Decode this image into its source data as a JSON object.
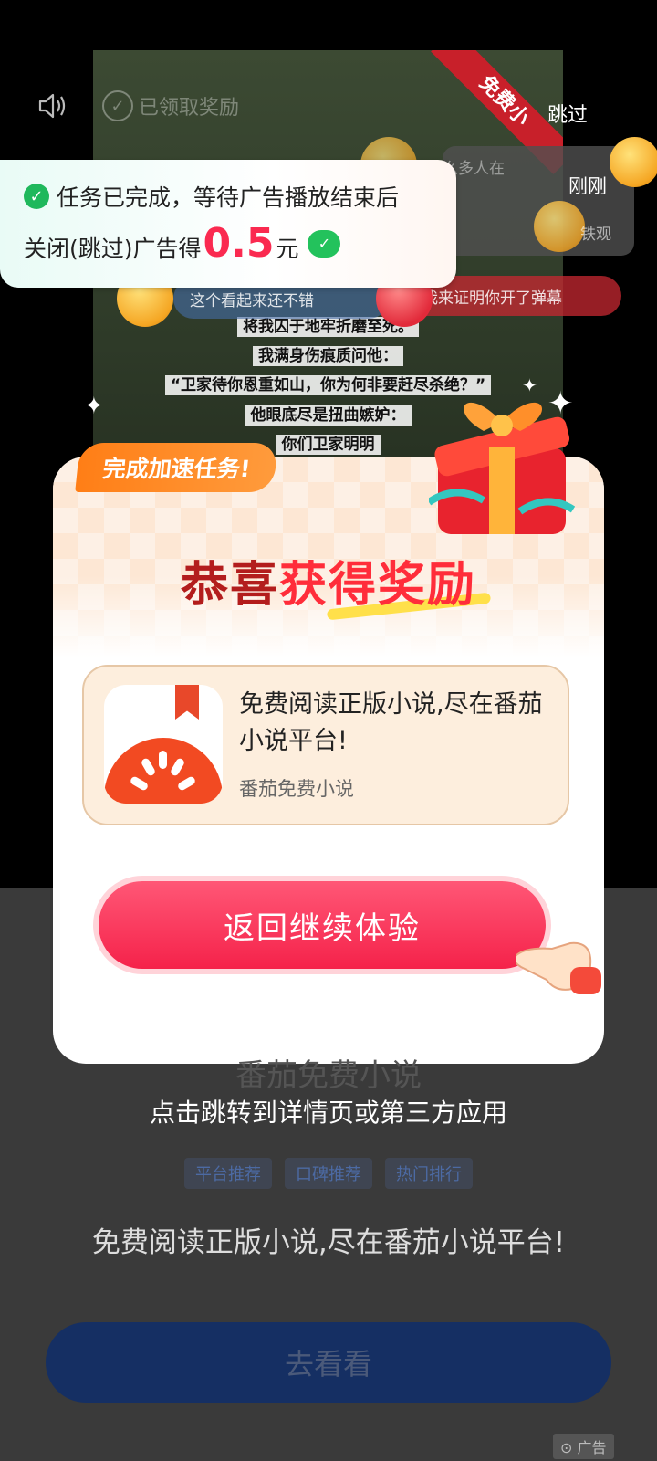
{
  "top_bar": {
    "claimed_label": "已领取奖励",
    "skip_label": "跳过"
  },
  "video": {
    "ribbon": "免费小",
    "lines": [
      "将我囚于地牢折磨至死。",
      "我满身伤痕质问他：",
      "“卫家待你恩重如山，你为何非要赶尽杀绝？”",
      "他眼底尽是扭曲嫉妒：",
      "你们卫家明明"
    ]
  },
  "danmu": {
    "items": [
      "这个看起来还不错",
      "我来证明你开了弹幕",
      "这么多人在",
      "铁观"
    ]
  },
  "notice": {
    "time": "刚刚"
  },
  "toast": {
    "line1": "任务已完成，等待广告播放结束后",
    "line2_prefix": "关闭(跳过)广告得",
    "amount": "0.5",
    "unit": "元"
  },
  "modal": {
    "badge": "完成加速任务!",
    "title_part1": "恭喜",
    "title_part2": "获得奖励",
    "app_desc": "免费阅读正版小说,尽在番茄小说平台!",
    "app_name": "番茄免费小说",
    "cta_label": "返回继续体验"
  },
  "hint": "点击跳转到详情页或第三方应用",
  "ad_page": {
    "title": "番茄免费小说",
    "tags": [
      "平台推荐",
      "口碑推荐",
      "热门排行"
    ],
    "description": "免费阅读正版小说,尽在番茄小说平台!",
    "button_label": "去看看",
    "ad_label": "广告"
  }
}
